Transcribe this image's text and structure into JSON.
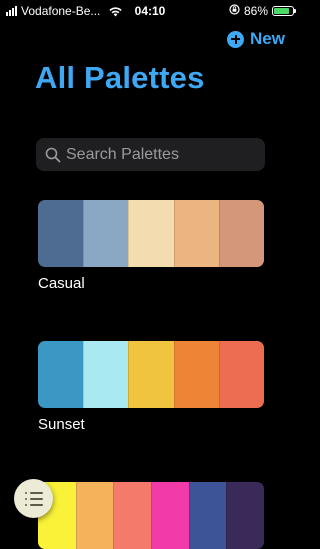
{
  "status_bar": {
    "carrier": "Vodafone-Be...",
    "time": "04:10",
    "battery_percent": "86%",
    "battery_level": 0.86
  },
  "header": {
    "new_label": "New",
    "title": "All Palettes"
  },
  "search": {
    "placeholder": "Search Palettes",
    "value": ""
  },
  "palettes": [
    {
      "name": "Casual",
      "colors": [
        "#4e6b92",
        "#8aa7c4",
        "#f3ddb0",
        "#ebb581",
        "#d59779"
      ]
    },
    {
      "name": "Sunset",
      "colors": [
        "#3b98c5",
        "#a9e9f2",
        "#f1c440",
        "#ee8435",
        "#ec6d52"
      ]
    },
    {
      "name": "",
      "colors": [
        "#f9f239",
        "#f4b35b",
        "#f47b6c",
        "#f33aa9",
        "#3d5497",
        "#3a2a5a"
      ]
    }
  ],
  "colors": {
    "accent": "#3ea8f4",
    "background": "#000000",
    "search_bg": "#1f1f21",
    "battery_green": "#4cd964",
    "menu_button_bg": "#ecebd6"
  },
  "icons": {
    "status_signal": "signal-bars-icon",
    "status_wifi": "wifi-icon",
    "status_lock": "orientation-lock-icon",
    "status_battery": "battery-charging-icon",
    "new": "plus-circle-icon",
    "search": "search-icon",
    "menu": "list-icon"
  }
}
